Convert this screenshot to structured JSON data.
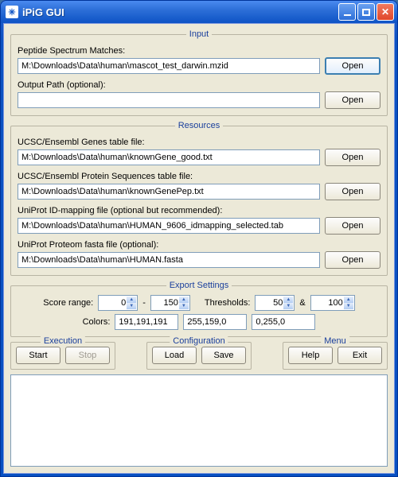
{
  "window": {
    "title": "iPiG GUI",
    "icon_glyph": "✳"
  },
  "input": {
    "legend": "Input",
    "psm_label": "Peptide Spectrum Matches:",
    "psm_value": "M:\\Downloads\\Data\\human\\mascot_test_darwin.mzid",
    "psm_open": "Open",
    "output_label": "Output Path (optional):",
    "output_value": "",
    "output_open": "Open"
  },
  "resources": {
    "legend": "Resources",
    "genes_label": "UCSC/Ensembl Genes table file:",
    "genes_value": "M:\\Downloads\\Data\\human\\knownGene_good.txt",
    "genes_open": "Open",
    "prot_label": "UCSC/Ensembl Protein Sequences table file:",
    "prot_value": "M:\\Downloads\\Data\\human\\knownGenePep.txt",
    "prot_open": "Open",
    "idmap_label": "UniProt ID-mapping file  (optional but recommended):",
    "idmap_value": "M:\\Downloads\\Data\\human\\HUMAN_9606_idmapping_selected.tab",
    "idmap_open": "Open",
    "fasta_label": "UniProt Proteom fasta file  (optional):",
    "fasta_value": "M:\\Downloads\\Data\\human\\HUMAN.fasta",
    "fasta_open": "Open"
  },
  "export": {
    "legend": "Export Settings",
    "score_label": "Score range:",
    "score_min": "0",
    "score_dash": "-",
    "score_max": "150",
    "thresh_label": "Thresholds:",
    "thresh1": "50",
    "amp": "&",
    "thresh2": "100",
    "colors_label": "Colors:",
    "color1": "191,191,191",
    "color2": "255,159,0",
    "color3": "0,255,0"
  },
  "execution": {
    "legend": "Execution",
    "start": "Start",
    "stop": "Stop"
  },
  "config": {
    "legend": "Configuration",
    "load": "Load",
    "save": "Save"
  },
  "menu": {
    "legend": "Menu",
    "help": "Help",
    "exit": "Exit"
  }
}
